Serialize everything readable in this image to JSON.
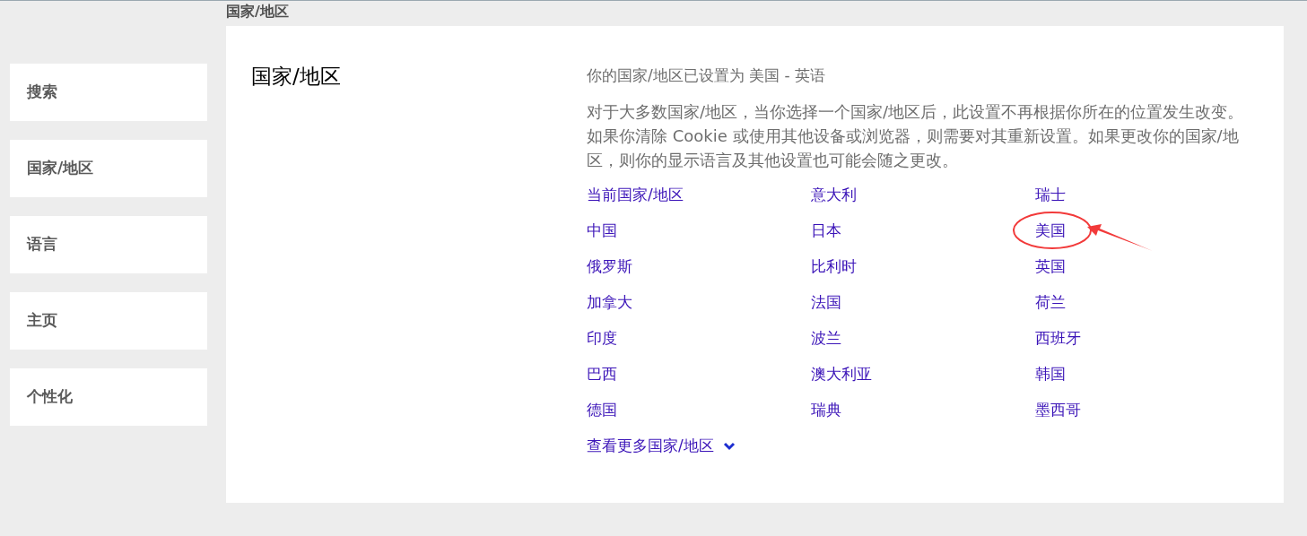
{
  "sidebar": {
    "items": [
      {
        "label": "搜索"
      },
      {
        "label": "国家/地区"
      },
      {
        "label": "语言"
      },
      {
        "label": "主页"
      },
      {
        "label": "个性化"
      }
    ]
  },
  "section_heading": "国家/地区",
  "card": {
    "title": "国家/地区",
    "current_setting": "你的国家/地区已设置为 美国 - 英语",
    "description": "对于大多数国家/地区，当你选择一个国家/地区后，此设置不再根据你所在的位置发生改变。如果你清除 Cookie 或使用其他设备或浏览器，则需要对其重新设置。如果更改你的国家/地区，则你的显示语言及其他设置也可能会随之更改。",
    "countries": [
      {
        "label": "当前国家/地区",
        "circled": false
      },
      {
        "label": "意大利",
        "circled": false
      },
      {
        "label": "瑞士",
        "circled": false
      },
      {
        "label": "中国",
        "circled": false
      },
      {
        "label": "日本",
        "circled": false
      },
      {
        "label": "美国",
        "circled": true
      },
      {
        "label": "俄罗斯",
        "circled": false
      },
      {
        "label": "比利时",
        "circled": false
      },
      {
        "label": "英国",
        "circled": false
      },
      {
        "label": "加拿大",
        "circled": false
      },
      {
        "label": "法国",
        "circled": false
      },
      {
        "label": "荷兰",
        "circled": false
      },
      {
        "label": "印度",
        "circled": false
      },
      {
        "label": "波兰",
        "circled": false
      },
      {
        "label": "西班牙",
        "circled": false
      },
      {
        "label": "巴西",
        "circled": false
      },
      {
        "label": "澳大利亚",
        "circled": false
      },
      {
        "label": "韩国",
        "circled": false
      },
      {
        "label": "德国",
        "circled": false
      },
      {
        "label": "瑞典",
        "circled": false
      },
      {
        "label": "墨西哥",
        "circled": false
      }
    ],
    "more_link": "查看更多国家/地区"
  }
}
